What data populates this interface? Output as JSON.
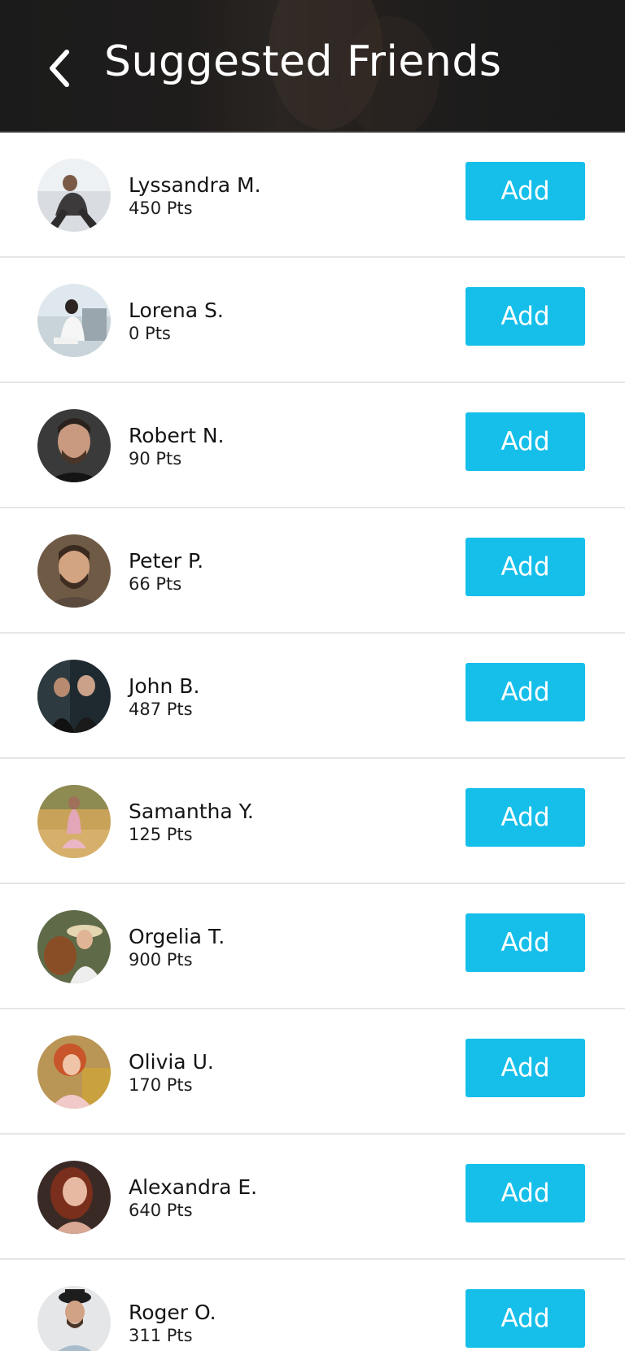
{
  "header": {
    "title": "Suggested Friends",
    "back_icon": "chevron-left-icon",
    "background_color": "#1b1b1b"
  },
  "accent_color": "#16bfea",
  "friends": [
    {
      "name": "Lyssandra M.",
      "points": "450 Pts",
      "add_label": "Add"
    },
    {
      "name": "Lorena S.",
      "points": "0 Pts",
      "add_label": "Add"
    },
    {
      "name": "Robert N.",
      "points": "90 Pts",
      "add_label": "Add"
    },
    {
      "name": "Peter P.",
      "points": "66 Pts",
      "add_label": "Add"
    },
    {
      "name": "John B.",
      "points": "487 Pts",
      "add_label": "Add"
    },
    {
      "name": "Samantha Y.",
      "points": "125 Pts",
      "add_label": "Add"
    },
    {
      "name": "Orgelia T.",
      "points": "900 Pts",
      "add_label": "Add"
    },
    {
      "name": "Olivia U.",
      "points": "170 Pts",
      "add_label": "Add"
    },
    {
      "name": "Alexandra E.",
      "points": "640 Pts",
      "add_label": "Add"
    },
    {
      "name": "Roger O.",
      "points": "311 Pts",
      "add_label": "Add"
    }
  ]
}
